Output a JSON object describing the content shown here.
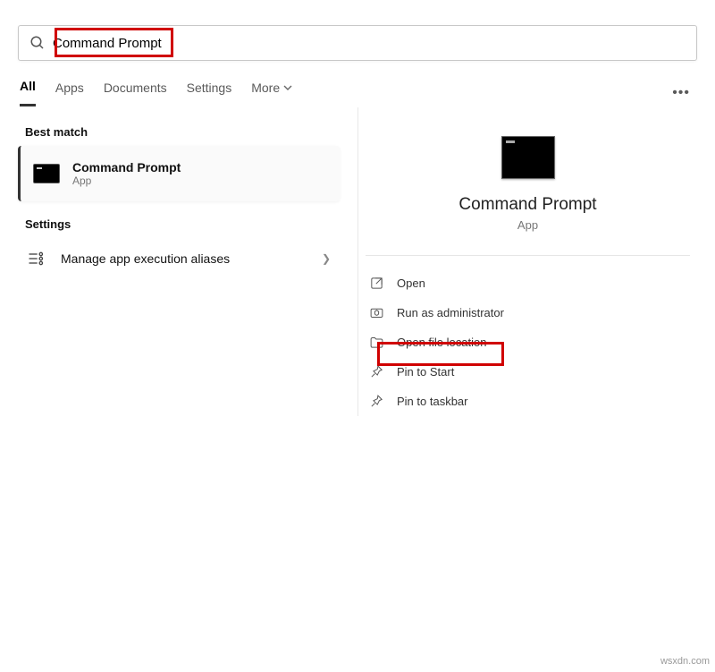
{
  "search": {
    "query": "Command Prompt",
    "placeholder": ""
  },
  "tabs": {
    "all": "All",
    "apps": "Apps",
    "documents": "Documents",
    "settings": "Settings",
    "more": "More"
  },
  "left": {
    "best_match_label": "Best match",
    "best": {
      "title": "Command Prompt",
      "sub": "App"
    },
    "settings_label": "Settings",
    "settings_item": "Manage app execution aliases"
  },
  "preview": {
    "title": "Command Prompt",
    "sub": "App"
  },
  "actions": {
    "open": "Open",
    "run_admin": "Run as administrator",
    "open_loc": "Open file location",
    "pin_start": "Pin to Start",
    "pin_taskbar": "Pin to taskbar"
  },
  "watermark": "wsxdn.com"
}
